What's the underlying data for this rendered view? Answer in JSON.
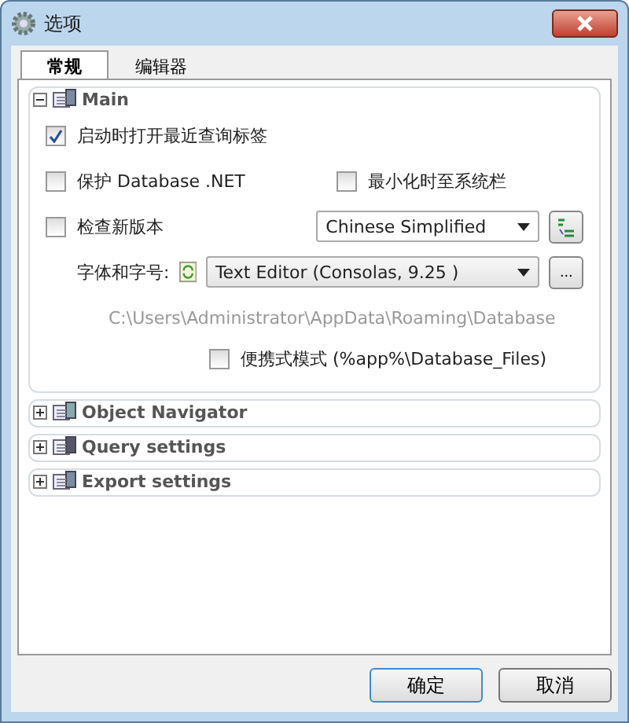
{
  "window": {
    "title": "选项"
  },
  "tabs": [
    {
      "label": "常规",
      "selected": true
    },
    {
      "label": "编辑器",
      "selected": false
    }
  ],
  "main": {
    "title": "Main",
    "expanded": true,
    "open_recent": {
      "label": "启动时打开最近查询标签",
      "checked": true
    },
    "protect": {
      "label": "保护 Database .NET",
      "checked": false
    },
    "minimize": {
      "label": "最小化时至系统栏",
      "checked": false
    },
    "check_updates": {
      "label": "检查新版本",
      "checked": false
    },
    "language": {
      "value": "Chinese Simplified"
    },
    "font": {
      "label": "字体和字号:",
      "value": "Text Editor (Consolas, 9.25 )",
      "browse": "..."
    },
    "path": "C:\\Users\\Administrator\\AppData\\Roaming\\Database",
    "portable": {
      "label": "便携式模式 (%app%\\Database_Files)",
      "checked": false
    }
  },
  "sections": [
    {
      "title": "Object Navigator",
      "expanded": false
    },
    {
      "title": "Query settings",
      "expanded": false
    },
    {
      "title": "Export settings",
      "expanded": false
    }
  ],
  "buttons": [
    {
      "label": "确定",
      "kind": "default"
    },
    {
      "label": "取消",
      "kind": "normal"
    }
  ]
}
